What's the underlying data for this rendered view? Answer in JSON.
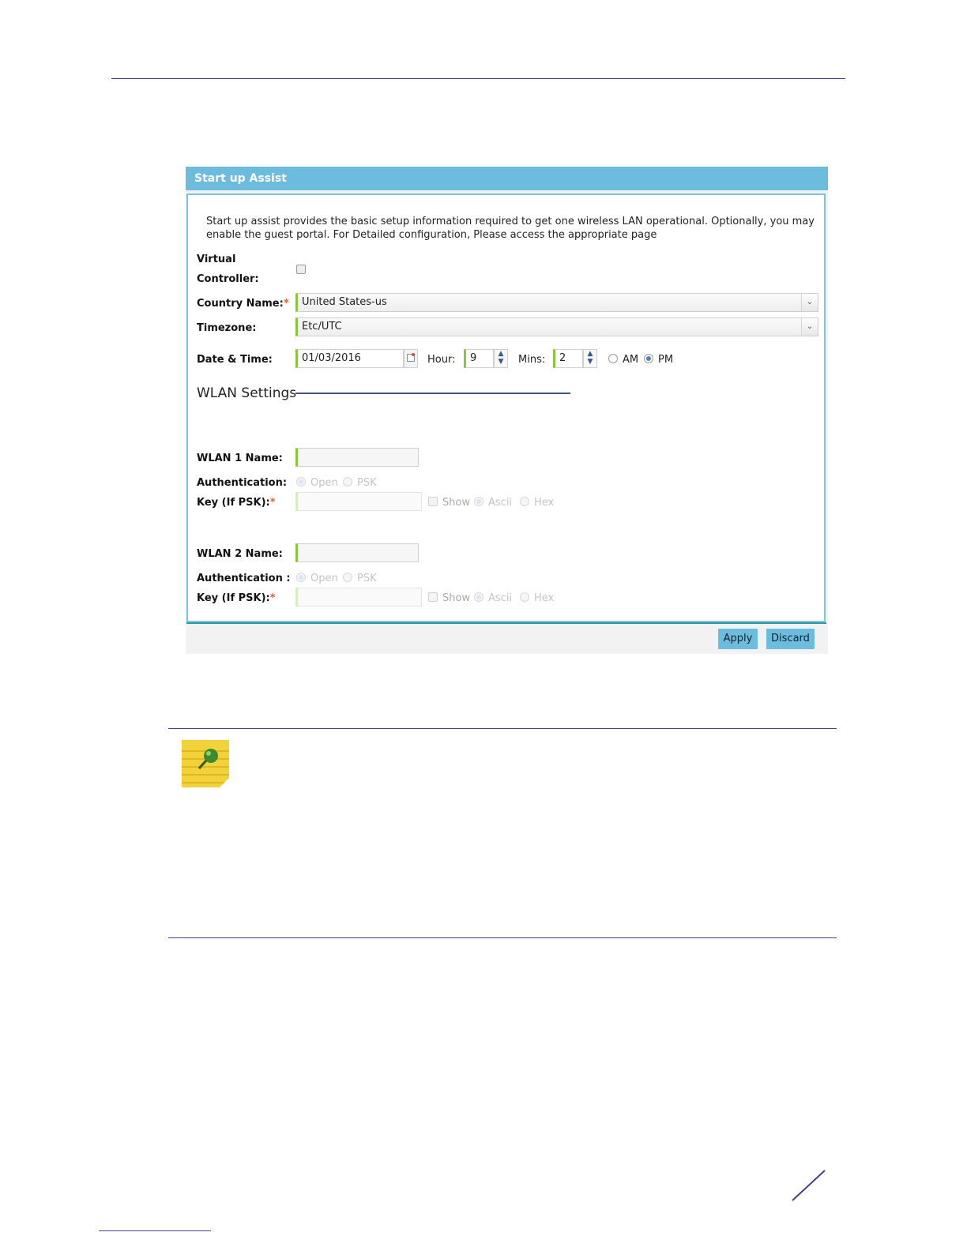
{
  "panel": {
    "title": "Start up Assist",
    "description": "Start up assist provides the basic setup information required to get one wireless LAN operational. Optionally, you may enable the guest portal. For Detailed configuration, Please access the appropriate page"
  },
  "form": {
    "virtual_label_line1": "Virtual",
    "virtual_label_line2": "Controller:",
    "virtual_checked": false,
    "country_label": "Country Name:",
    "country_value": "United States-us",
    "timezone_label": "Timezone:",
    "timezone_value": "Etc/UTC",
    "datetime_label": "Date & Time:",
    "date_value": "01/03/2016",
    "hour_label": "Hour:",
    "hour_value": "9",
    "mins_label": "Mins:",
    "mins_value": "2",
    "am_label": "AM",
    "pm_label": "PM",
    "meridiem_selected": "PM",
    "required_marker": "*"
  },
  "wlan": {
    "section_title": "WLAN Settings",
    "wlan1": {
      "name_label": "WLAN 1 Name:",
      "name_value": "",
      "auth_label": "Authentication:",
      "open_label": "Open",
      "psk_label": "PSK",
      "key_label": "Key (If PSK):",
      "key_value": "",
      "show_label": "Show",
      "ascii_label": "Ascii",
      "hex_label": "Hex"
    },
    "wlan2": {
      "name_label": "WLAN 2 Name:",
      "name_value": "",
      "auth_label": "Authentication :",
      "open_label": "Open",
      "psk_label": "PSK",
      "key_label": "Key (If PSK):",
      "key_value": "",
      "show_label": "Show",
      "ascii_label": "Ascii",
      "hex_label": "Hex"
    }
  },
  "buttons": {
    "apply": "Apply",
    "discard": "Discard"
  },
  "icons": {
    "note": "note-pin-icon",
    "calendar": "calendar-icon",
    "dropdown": "chevron-down-icon",
    "spinner": "spinner-arrows-icon"
  },
  "colors": {
    "header": "#6cbcde",
    "rules": "#4a3d8f",
    "required": "#e8602c",
    "field_accent": "#8cc63f"
  }
}
